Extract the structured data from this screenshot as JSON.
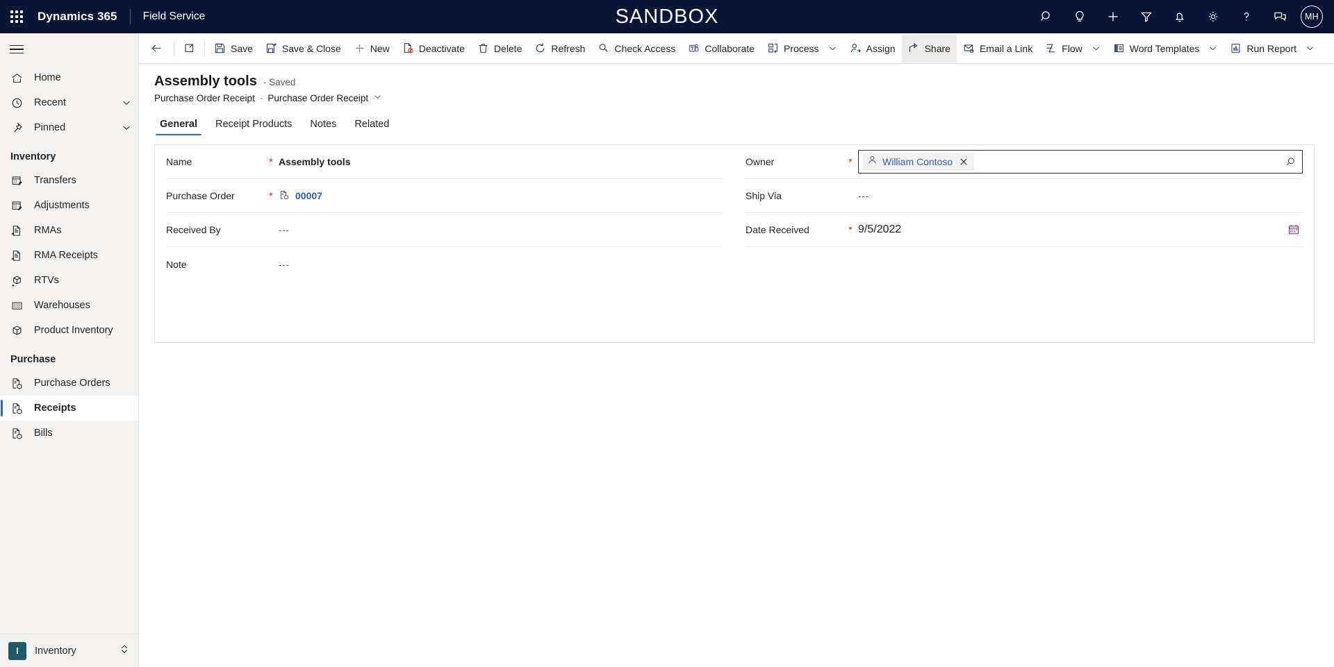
{
  "header": {
    "waffle_label": "app-launcher",
    "brand": "Dynamics 365",
    "app_name": "Field Service",
    "environment_banner": "SANDBOX",
    "icons": [
      {
        "name": "search-icon",
        "label": "Search"
      },
      {
        "name": "lightbulb-icon",
        "label": "Assistant"
      },
      {
        "name": "plus-icon",
        "label": "Quick create"
      },
      {
        "name": "filter-icon",
        "label": "Filter"
      },
      {
        "name": "bell-icon",
        "label": "Notifications"
      },
      {
        "name": "gear-icon",
        "label": "Settings"
      },
      {
        "name": "question-icon",
        "label": "Help"
      },
      {
        "name": "feedback-icon",
        "label": "Feedback"
      }
    ],
    "avatar_initials": "MH"
  },
  "commandbar": {
    "back_label": "Back",
    "popout_label": "Open in new window",
    "buttons": [
      {
        "name": "save-button",
        "label": "Save",
        "icon": "save-icon",
        "caret": false,
        "active": false
      },
      {
        "name": "save-and-close-button",
        "label": "Save & Close",
        "icon": "save-close-icon",
        "caret": false,
        "active": false
      },
      {
        "name": "new-button",
        "label": "New",
        "icon": "plus-icon",
        "caret": false,
        "active": false
      },
      {
        "name": "deactivate-button",
        "label": "Deactivate",
        "icon": "deactivate-icon",
        "caret": false,
        "active": false
      },
      {
        "name": "delete-button",
        "label": "Delete",
        "icon": "trash-icon",
        "caret": false,
        "active": false
      },
      {
        "name": "refresh-button",
        "label": "Refresh",
        "icon": "refresh-icon",
        "caret": false,
        "active": false
      },
      {
        "name": "check-access-button",
        "label": "Check Access",
        "icon": "key-icon",
        "caret": false,
        "active": false
      },
      {
        "name": "collaborate-button",
        "label": "Collaborate",
        "icon": "teams-icon",
        "caret": false,
        "active": false
      },
      {
        "name": "process-button",
        "label": "Process",
        "icon": "process-icon",
        "caret": true,
        "active": false
      },
      {
        "name": "assign-button",
        "label": "Assign",
        "icon": "assign-icon",
        "caret": false,
        "active": false
      },
      {
        "name": "share-button",
        "label": "Share",
        "icon": "share-icon",
        "caret": false,
        "active": true
      },
      {
        "name": "email-a-link-button",
        "label": "Email a Link",
        "icon": "email-link-icon",
        "caret": false,
        "active": false
      },
      {
        "name": "flow-button",
        "label": "Flow",
        "icon": "flow-icon",
        "caret": true,
        "active": false
      },
      {
        "name": "word-templates-button",
        "label": "Word Templates",
        "icon": "word-icon",
        "caret": true,
        "active": false
      },
      {
        "name": "run-report-button",
        "label": "Run Report",
        "icon": "report-icon",
        "caret": true,
        "active": false
      }
    ]
  },
  "sidebar": {
    "menu_label": "Site map",
    "items": [
      {
        "name": "sidebar-item-home",
        "label": "Home",
        "icon": "home-icon",
        "chevron": false,
        "selected": false
      },
      {
        "name": "sidebar-item-recent",
        "label": "Recent",
        "icon": "clock-icon",
        "chevron": true,
        "selected": false
      },
      {
        "name": "sidebar-item-pinned",
        "label": "Pinned",
        "icon": "pin-icon",
        "chevron": true,
        "selected": false
      }
    ],
    "groups": [
      {
        "name": "sidebar-group-inventory",
        "title": "Inventory",
        "items": [
          {
            "name": "sidebar-item-transfers",
            "label": "Transfers",
            "icon": "transfer-icon",
            "selected": false
          },
          {
            "name": "sidebar-item-adjustments",
            "label": "Adjustments",
            "icon": "adjustment-icon",
            "selected": false
          },
          {
            "name": "sidebar-item-rmas",
            "label": "RMAs",
            "icon": "document-return-icon",
            "selected": false
          },
          {
            "name": "sidebar-item-rma-receipts",
            "label": "RMA Receipts",
            "icon": "document-return-icon",
            "selected": false
          },
          {
            "name": "sidebar-item-rtvs",
            "label": "RTVs",
            "icon": "box-return-icon",
            "selected": false
          },
          {
            "name": "sidebar-item-warehouses",
            "label": "Warehouses",
            "icon": "building-icon",
            "selected": false
          },
          {
            "name": "sidebar-item-product-inventory",
            "label": "Product Inventory",
            "icon": "box-icon",
            "selected": false
          }
        ]
      },
      {
        "name": "sidebar-group-purchase",
        "title": "Purchase",
        "items": [
          {
            "name": "sidebar-item-purchase-orders",
            "label": "Purchase Orders",
            "icon": "document-box-icon",
            "selected": false
          },
          {
            "name": "sidebar-item-receipts",
            "label": "Receipts",
            "icon": "document-box-icon",
            "selected": true
          },
          {
            "name": "sidebar-item-bills",
            "label": "Bills",
            "icon": "document-box-icon",
            "selected": false
          }
        ]
      }
    ],
    "area_switcher": {
      "badge": "I",
      "label": "Inventory"
    }
  },
  "record": {
    "title": "Assembly tools",
    "state": "- Saved",
    "breadcrumb_parent": "Purchase Order Receipt",
    "breadcrumb_separator": "·",
    "breadcrumb_current": "Purchase Order Receipt"
  },
  "tabs": [
    {
      "name": "tab-general",
      "label": "General",
      "active": true
    },
    {
      "name": "tab-receipt-products",
      "label": "Receipt Products",
      "active": false
    },
    {
      "name": "tab-notes",
      "label": "Notes",
      "active": false
    },
    {
      "name": "tab-related",
      "label": "Related",
      "active": false
    }
  ],
  "form": {
    "left": [
      {
        "name": "field-name",
        "label": "Name",
        "required": true,
        "value": "Assembly tools",
        "kind": "text-bold"
      },
      {
        "name": "field-purchase-order",
        "label": "Purchase Order",
        "required": true,
        "value": "00007",
        "kind": "lookup-link",
        "icon": "document-box-icon"
      },
      {
        "name": "field-received-by",
        "label": "Received By",
        "required": false,
        "value": "---",
        "kind": "empty"
      },
      {
        "name": "field-note",
        "label": "Note",
        "required": false,
        "value": "---",
        "kind": "empty"
      }
    ],
    "right": [
      {
        "name": "field-owner",
        "label": "Owner",
        "required": true,
        "value": "William Contoso",
        "kind": "lookup-active",
        "chip_icon": "person-icon",
        "clear_icon": "close-icon",
        "search_icon": "search-icon"
      },
      {
        "name": "field-ship-via",
        "label": "Ship Via",
        "required": false,
        "value": "---",
        "kind": "empty"
      },
      {
        "name": "field-date-received",
        "label": "Date Received",
        "required": true,
        "value": "9/5/2022",
        "kind": "date",
        "calendar_icon": "calendar-icon"
      }
    ]
  },
  "colors": {
    "header_bg": "#0b1538",
    "accent": "#2266e3",
    "link": "#2b5bc9",
    "required": "#c0392b",
    "sidebar_bg": "#f3f2f1",
    "area_badge": "#20596b"
  }
}
